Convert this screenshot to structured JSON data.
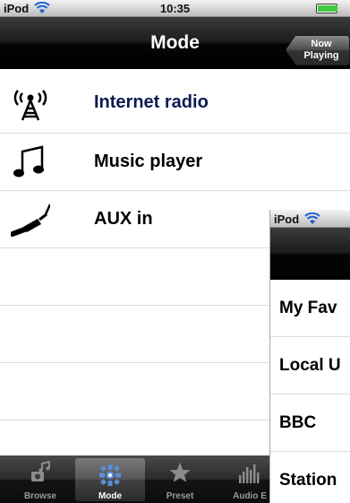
{
  "status": {
    "carrier": "iPod",
    "time": "10:35"
  },
  "navbar": {
    "title": "Mode",
    "now_playing_line1": "Now",
    "now_playing_line2": "Playing"
  },
  "mode_list": [
    {
      "label": "Internet radio",
      "icon": "radio-tower-icon"
    },
    {
      "label": "Music player",
      "icon": "music-note-icon"
    },
    {
      "label": "AUX in",
      "icon": "aux-cable-icon"
    }
  ],
  "tabs": [
    {
      "label": "Browse",
      "icon": "browse-icon"
    },
    {
      "label": "Mode",
      "icon": "mode-icon",
      "selected": true
    },
    {
      "label": "Preset",
      "icon": "star-icon"
    },
    {
      "label": "Audio E",
      "icon": "equalizer-icon"
    }
  ],
  "overlay": {
    "status": {
      "carrier": "iPod"
    },
    "rows": [
      "My Fav",
      "Local U",
      "BBC",
      "Station"
    ]
  },
  "colors": {
    "accent_label": "#0c1a52",
    "battery": "#3ec93e",
    "selected_tab_icon": "#5a8fd6"
  }
}
